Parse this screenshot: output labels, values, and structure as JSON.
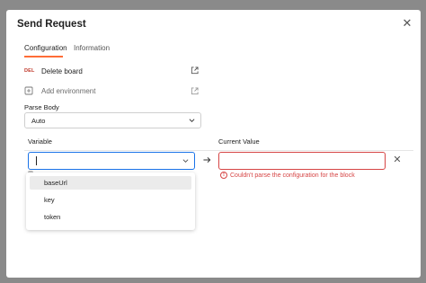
{
  "modal": {
    "title": "Send Request",
    "close_glyph": "✕"
  },
  "tabs": [
    {
      "label": "Configuration",
      "active": true
    },
    {
      "label": "Information",
      "active": false
    }
  ],
  "actions": {
    "delete_board": {
      "badge": "DEL",
      "label": "Delete board"
    },
    "add_environment": {
      "label": "Add environment"
    }
  },
  "parse_body": {
    "label": "Parse Body",
    "selected": "Auto"
  },
  "columns": {
    "variable": "Variable",
    "current_value": "Current Value"
  },
  "variable_input": {
    "value": ""
  },
  "value_input": {
    "value": ""
  },
  "remove_glyph": "✕",
  "error": {
    "message": "Couldn't parse the configuration for the block"
  },
  "dropdown": {
    "options": [
      "baseUrl",
      "key",
      "token"
    ],
    "highlighted_index": 0
  },
  "colors": {
    "accent": "#ff6c37",
    "focus": "#1a73e8",
    "error": "#d64545"
  }
}
